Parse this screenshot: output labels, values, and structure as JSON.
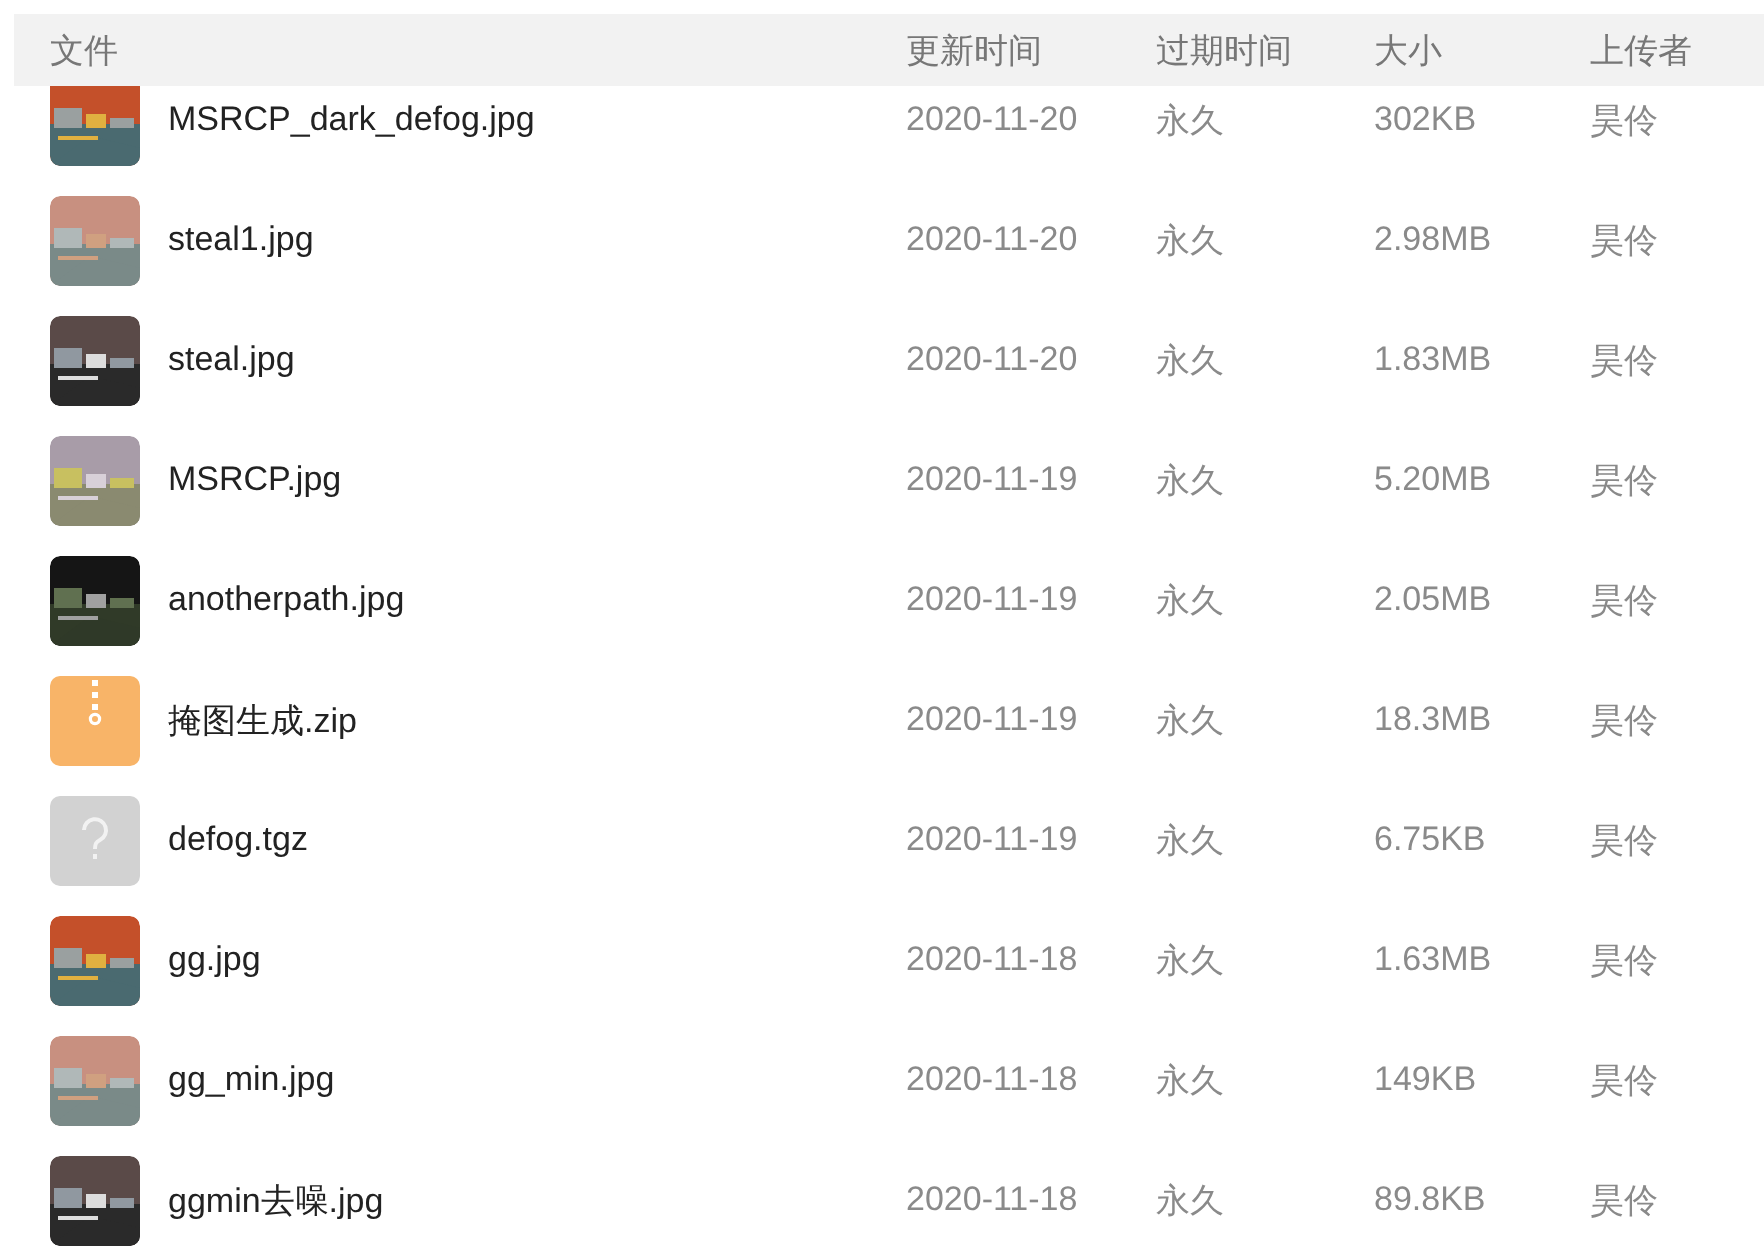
{
  "table": {
    "columns": [
      "文件",
      "更新时间",
      "过期时间",
      "大小",
      "上传者"
    ],
    "rows": [
      {
        "name": "MSRCP_dark_defog.jpg",
        "updated": "2020-11-20",
        "expires": "永久",
        "size": "302KB",
        "uploader": "昊伶"
      },
      {
        "name": "steal1.jpg",
        "updated": "2020-11-20",
        "expires": "永久",
        "size": "2.98MB",
        "uploader": "昊伶"
      },
      {
        "name": "steal.jpg",
        "updated": "2020-11-20",
        "expires": "永久",
        "size": "1.83MB",
        "uploader": "昊伶"
      },
      {
        "name": "MSRCP.jpg",
        "updated": "2020-11-19",
        "expires": "永久",
        "size": "5.20MB",
        "uploader": "昊伶"
      },
      {
        "name": "anotherpath.jpg",
        "updated": "2020-11-19",
        "expires": "永久",
        "size": "2.05MB",
        "uploader": "昊伶"
      },
      {
        "thumbnail": {
          "kind": "zip"
        },
        "name": "掩图生成.zip",
        "updated": "2020-11-19",
        "expires": "永久",
        "size": "18.3MB",
        "uploader": "昊伶"
      },
      {
        "thumbnail": {
          "kind": "unknown"
        },
        "name": "defog.tgz",
        "updated": "2020-11-19",
        "expires": "永久",
        "size": "6.75KB",
        "uploader": "昊伶"
      },
      {
        "name": "gg.jpg",
        "updated": "2020-11-18",
        "expires": "永久",
        "size": "1.63MB",
        "uploader": "昊伶"
      },
      {
        "name": "gg_min.jpg",
        "updated": "2020-11-18",
        "expires": "永久",
        "size": "149KB",
        "uploader": "昊伶"
      },
      {
        "name": "ggmin去噪.jpg",
        "updated": "2020-11-18",
        "expires": "永久",
        "size": "89.8KB",
        "uploader": "昊伶"
      }
    ]
  }
}
